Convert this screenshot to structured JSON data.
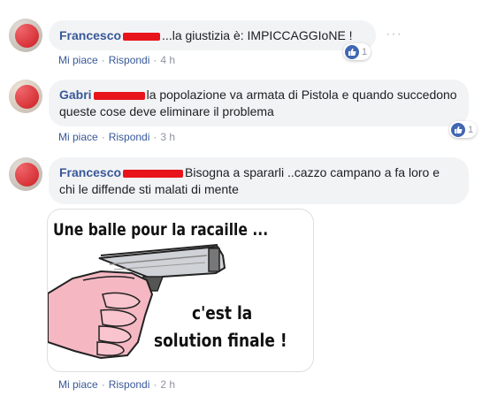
{
  "comments": [
    {
      "author": "Francesco",
      "text": "...la giustizia è: IMPICCAGGIoNE !",
      "like_label": "Mi piace",
      "reply_label": "Rispondi",
      "time": "4 h",
      "reaction_count": "1",
      "more": "···"
    },
    {
      "author": "Gabri",
      "text": "la popolazione va armata di Pistola e quando succedono queste cose deve eliminare il problema",
      "like_label": "Mi piace",
      "reply_label": "Rispondi",
      "time": "3 h",
      "reaction_count": "1"
    },
    {
      "author": "Francesco",
      "text": "Bisogna a spararli ..cazzo campano a fa loro e chi le diffende sti malati di mente",
      "like_label": "Mi piace",
      "reply_label": "Rispondi",
      "time": "2 h",
      "meme": {
        "top_text": "Une balle pour la racaille ...",
        "line1": "c'est la",
        "line2": "solution finale !"
      }
    }
  ],
  "colors": {
    "author": "#385898",
    "bubble": "#f2f3f5",
    "redaction": "#e8141b",
    "like": "#4267b2"
  }
}
